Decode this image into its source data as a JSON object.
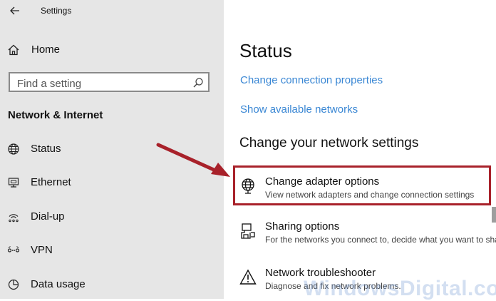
{
  "window": {
    "title": "Settings"
  },
  "sidebar": {
    "home_label": "Home",
    "search_placeholder": "Find a setting",
    "section_header": "Network & Internet",
    "items": [
      {
        "label": "Status",
        "icon": "globe-icon"
      },
      {
        "label": "Ethernet",
        "icon": "ethernet-icon"
      },
      {
        "label": "Dial-up",
        "icon": "dialup-icon"
      },
      {
        "label": "VPN",
        "icon": "vpn-icon"
      },
      {
        "label": "Data usage",
        "icon": "data-usage-icon"
      }
    ]
  },
  "main": {
    "page_title": "Status",
    "links": [
      "Change connection properties",
      "Show available networks"
    ],
    "section_title": "Change your network settings",
    "settings": [
      {
        "title": "Change adapter options",
        "description": "View network adapters and change connection settings",
        "icon": "adapter-icon"
      },
      {
        "title": "Sharing options",
        "description": "For the networks you connect to, decide what you want to share",
        "icon": "sharing-icon"
      },
      {
        "title": "Network troubleshooter",
        "description": "Diagnose and fix network problems.",
        "icon": "warning-icon"
      }
    ]
  },
  "annotation": {
    "highlight_color": "#a8212a",
    "arrow_color": "#a8212a"
  },
  "watermark": "WindowsDigital.com",
  "colors": {
    "sidebar_bg": "#e6e6e6",
    "link": "#3a87d4"
  }
}
